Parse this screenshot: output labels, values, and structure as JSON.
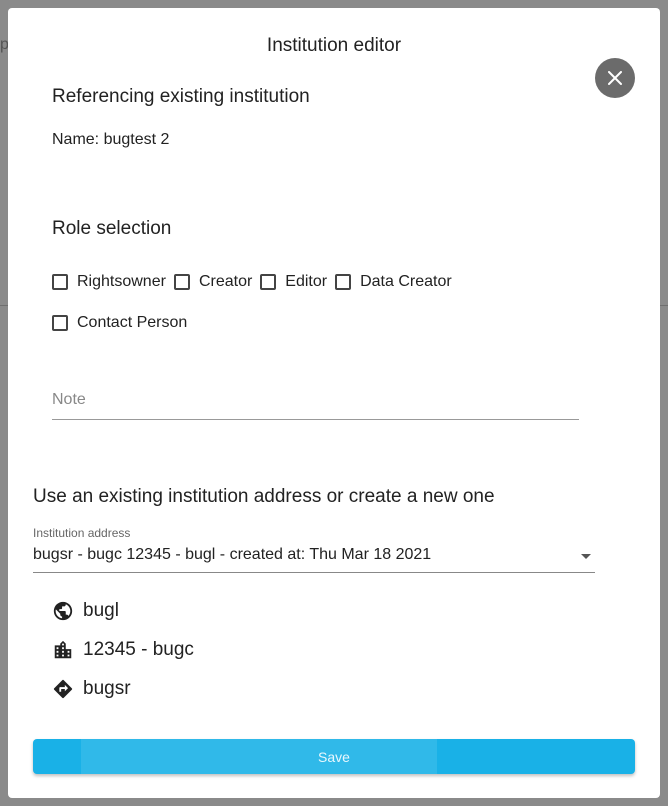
{
  "backdrop": {
    "text": "p"
  },
  "dialog": {
    "title": "Institution editor",
    "close_icon": "close-icon",
    "section_existing": {
      "heading": "Referencing existing institution",
      "name_line": "Name: bugtest 2"
    },
    "roles": {
      "heading": "Role selection",
      "rows": [
        [
          {
            "label": "Rightsowner",
            "checked": false
          },
          {
            "label": "Creator",
            "checked": false
          },
          {
            "label": "Editor",
            "checked": false
          },
          {
            "label": "Data Creator",
            "checked": false
          }
        ],
        [
          {
            "label": "Contact Person",
            "checked": false
          }
        ]
      ]
    },
    "note": {
      "placeholder": "Note",
      "value": ""
    },
    "address_section": {
      "heading": "Use an existing institution address or create a new one",
      "field_label": "Institution address",
      "selected_value": "bugsr - bugc 12345 - bugl - created at: Thu Mar 18 2021"
    },
    "address_details": [
      {
        "icon": "globe-icon",
        "text": "bugl"
      },
      {
        "icon": "city-icon",
        "text": "12345 - bugc"
      },
      {
        "icon": "directions-icon",
        "text": "bugsr"
      }
    ],
    "save_label": "Save",
    "colors": {
      "save": "#19b1e7",
      "close": "#6b6b6b",
      "backdrop": "#8a8a8a"
    }
  }
}
